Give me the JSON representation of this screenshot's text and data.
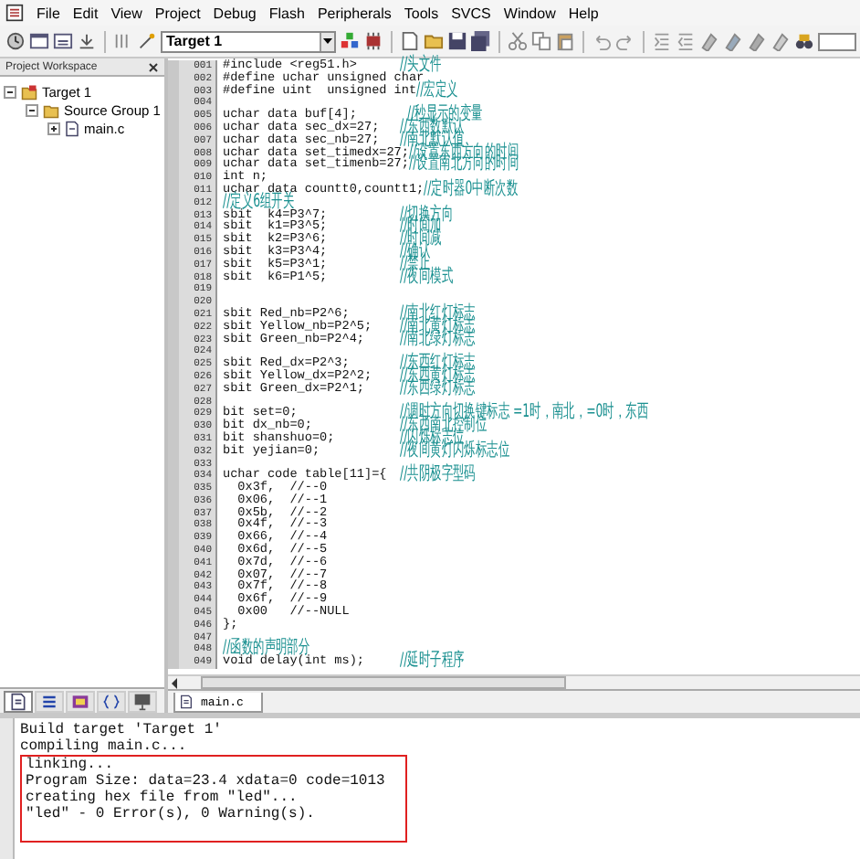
{
  "menu": [
    "File",
    "Edit",
    "View",
    "Project",
    "Debug",
    "Flash",
    "Peripherals",
    "Tools",
    "SVCS",
    "Window",
    "Help"
  ],
  "toolbar": {
    "target": "Target 1"
  },
  "workspace": {
    "title": "Project Workspace",
    "tree": [
      {
        "label": "Target 1",
        "expanded": true,
        "children": [
          {
            "label": "Source Group 1",
            "expanded": true,
            "children": [
              {
                "label": "main.c",
                "expanded": false
              }
            ]
          }
        ]
      }
    ],
    "tabs": [
      {
        "kind": "files",
        "selected": true
      },
      {
        "kind": "registers",
        "selected": false
      },
      {
        "kind": "books",
        "selected": false
      },
      {
        "kind": "functions",
        "selected": false
      },
      {
        "kind": "templates",
        "selected": false
      }
    ]
  },
  "editor": {
    "lines": [
      {
        "num": "001",
        "code": "#include <reg51.h>",
        "comment": "//头文件"
      },
      {
        "num": "002",
        "code": "#define uchar unsigned char"
      },
      {
        "num": "003",
        "code": "#define uint  unsigned int",
        "comment": "//宏定义"
      },
      {
        "num": "004"
      },
      {
        "num": "005",
        "code": "uchar data buf[4];",
        "comment": "  //秒显示的变量"
      },
      {
        "num": "006",
        "code": "uchar data sec_dx=27;",
        "comment": "//东西数默认"
      },
      {
        "num": "007",
        "code": "uchar data sec_nb=27;",
        "comment": "//南北默认值"
      },
      {
        "num": "008",
        "code": "uchar data set_timedx=27;",
        "comment": "//设置东西方向的时间"
      },
      {
        "num": "009",
        "code": "uchar data set_timenb=27;",
        "comment": "//设置南北方向的时间"
      },
      {
        "num": "010",
        "code": "int n;"
      },
      {
        "num": "011",
        "code": "uchar data countt0,countt1;",
        "comment": "//定时器0中断次数"
      },
      {
        "num": "012",
        "comment": "//定义6组开关"
      },
      {
        "num": "013",
        "code": "sbit  k4=P3^7;",
        "comment": "//切换方向"
      },
      {
        "num": "014",
        "code": "sbit  k1=P3^5;",
        "comment": "//时间加"
      },
      {
        "num": "015",
        "code": "sbit  k2=P3^6;",
        "comment": "//时间减"
      },
      {
        "num": "016",
        "code": "sbit  k3=P3^4;",
        "comment": "//确认"
      },
      {
        "num": "017",
        "code": "sbit  k5=P3^1;",
        "comment": "//禁止"
      },
      {
        "num": "018",
        "code": "sbit  k6=P1^5;",
        "comment": "//夜间模式"
      },
      {
        "num": "019"
      },
      {
        "num": "020"
      },
      {
        "num": "021",
        "code": "sbit Red_nb=P2^6;",
        "comment": "//南北红灯标志"
      },
      {
        "num": "022",
        "code": "sbit Yellow_nb=P2^5;",
        "comment": "//南北黄灯标志"
      },
      {
        "num": "023",
        "code": "sbit Green_nb=P2^4;",
        "comment": "//南北绿灯标志"
      },
      {
        "num": "024"
      },
      {
        "num": "025",
        "code": "sbit Red_dx=P2^3;",
        "comment": "//东西红灯标志"
      },
      {
        "num": "026",
        "code": "sbit Yellow_dx=P2^2;",
        "comment": "//东西黄灯标志"
      },
      {
        "num": "027",
        "code": "sbit Green_dx=P2^1;",
        "comment": "//东西绿灯标志"
      },
      {
        "num": "028"
      },
      {
        "num": "029",
        "code": "bit set=0;",
        "comment": "//调时方向切换键标志 =1时，南北，=0时，东西"
      },
      {
        "num": "030",
        "code": "bit dx_nb=0;",
        "comment": "//东西南北控制位"
      },
      {
        "num": "031",
        "code": "bit shanshuo=0;",
        "comment": "//闪烁标志位"
      },
      {
        "num": "032",
        "code": "bit yejian=0;",
        "comment": "//夜间黄灯闪烁标志位"
      },
      {
        "num": "033"
      },
      {
        "num": "034",
        "code": "uchar code table[11]={",
        "comment": "//共阴极字型码"
      },
      {
        "num": "035",
        "code": "  0x3f,  //--0"
      },
      {
        "num": "036",
        "code": "  0x06,  //--1"
      },
      {
        "num": "037",
        "code": "  0x5b,  //--2"
      },
      {
        "num": "038",
        "code": "  0x4f,  //--3"
      },
      {
        "num": "039",
        "code": "  0x66,  //--4"
      },
      {
        "num": "040",
        "code": "  0x6d,  //--5"
      },
      {
        "num": "041",
        "code": "  0x7d,  //--6"
      },
      {
        "num": "042",
        "code": "  0x07,  //--7"
      },
      {
        "num": "043",
        "code": "  0x7f,  //--8"
      },
      {
        "num": "044",
        "code": "  0x6f,  //--9"
      },
      {
        "num": "045",
        "code": "  0x00   //--NULL"
      },
      {
        "num": "046",
        "code": "};"
      },
      {
        "num": "047"
      },
      {
        "num": "048",
        "comment": "//函数的声明部分"
      },
      {
        "num": "049",
        "code": "void delay(int ms);",
        "comment": "//延时子程序"
      }
    ],
    "file_tabs": [
      {
        "label": "main.c",
        "selected": true
      }
    ]
  },
  "output": {
    "lines": [
      "Build target 'Target 1'",
      "compiling main.c..."
    ],
    "boxed_lines": [
      "linking...",
      "Program Size: data=23.4 xdata=0 code=1013",
      "creating hex file from \"led\"...",
      "\"led\" - 0 Error(s), 0 Warning(s)."
    ]
  }
}
